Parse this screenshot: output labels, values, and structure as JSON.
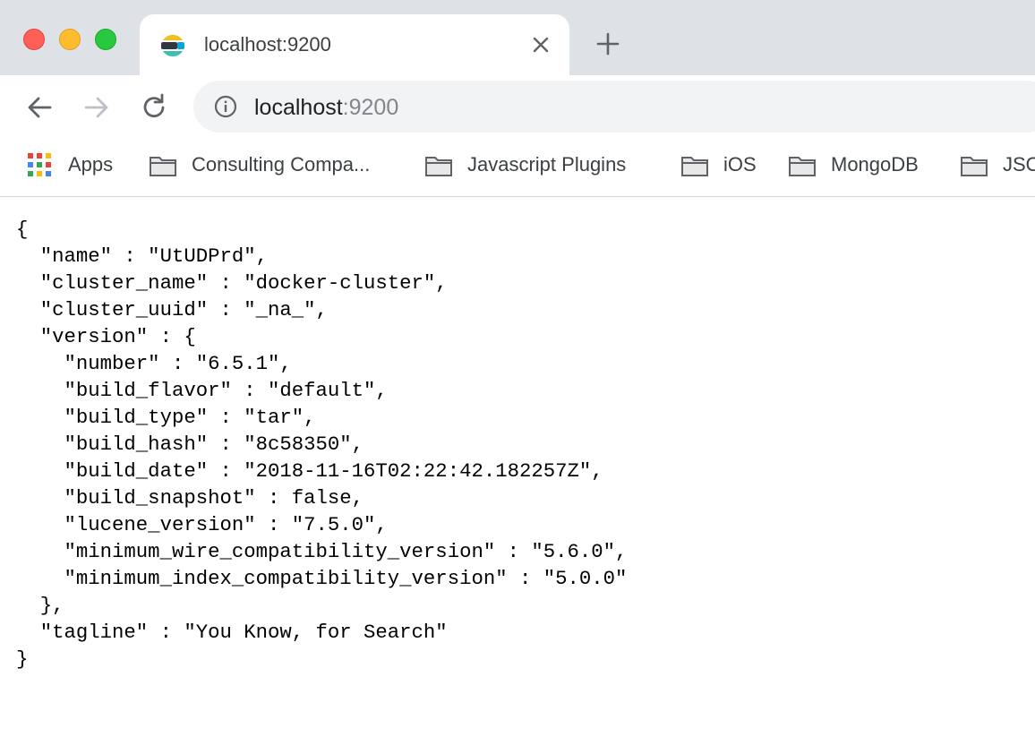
{
  "window": {
    "traffic_lights": [
      "close",
      "minimize",
      "zoom"
    ]
  },
  "tab": {
    "title": "localhost:9200",
    "favicon": "elasticsearch-logo-icon",
    "close_icon": "close-icon"
  },
  "new_tab_icon": "plus-icon",
  "toolbar": {
    "back_icon": "arrow-left-icon",
    "forward_icon": "arrow-right-icon",
    "reload_icon": "reload-icon",
    "omnibox": {
      "info_icon": "info-icon",
      "host": "localhost",
      "port": ":9200"
    }
  },
  "bookmarks": {
    "items": [
      {
        "label": "Apps",
        "icon": "apps-grid-icon"
      },
      {
        "label": "Consulting Compa...",
        "icon": "folder-icon"
      },
      {
        "label": "Javascript Plugins",
        "icon": "folder-icon"
      },
      {
        "label": "iOS",
        "icon": "folder-icon"
      },
      {
        "label": "MongoDB",
        "icon": "folder-icon"
      },
      {
        "label": "JSO",
        "icon": "folder-icon"
      }
    ]
  },
  "page": {
    "lines": [
      "{",
      "  \"name\" : \"UtUDPrd\",",
      "  \"cluster_name\" : \"docker-cluster\",",
      "  \"cluster_uuid\" : \"_na_\",",
      "  \"version\" : {",
      "    \"number\" : \"6.5.1\",",
      "    \"build_flavor\" : \"default\",",
      "    \"build_type\" : \"tar\",",
      "    \"build_hash\" : \"8c58350\",",
      "    \"build_date\" : \"2018-11-16T02:22:42.182257Z\",",
      "    \"build_snapshot\" : false,",
      "    \"lucene_version\" : \"7.5.0\",",
      "    \"minimum_wire_compatibility_version\" : \"5.6.0\",",
      "    \"minimum_index_compatibility_version\" : \"5.0.0\"",
      "  },",
      "  \"tagline\" : \"You Know, for Search\"",
      "}"
    ]
  },
  "colors": {
    "tabstrip": "#dee1e6",
    "omnibox": "#f1f3f4",
    "text": "#3c4043",
    "url_port": "#80868b"
  }
}
